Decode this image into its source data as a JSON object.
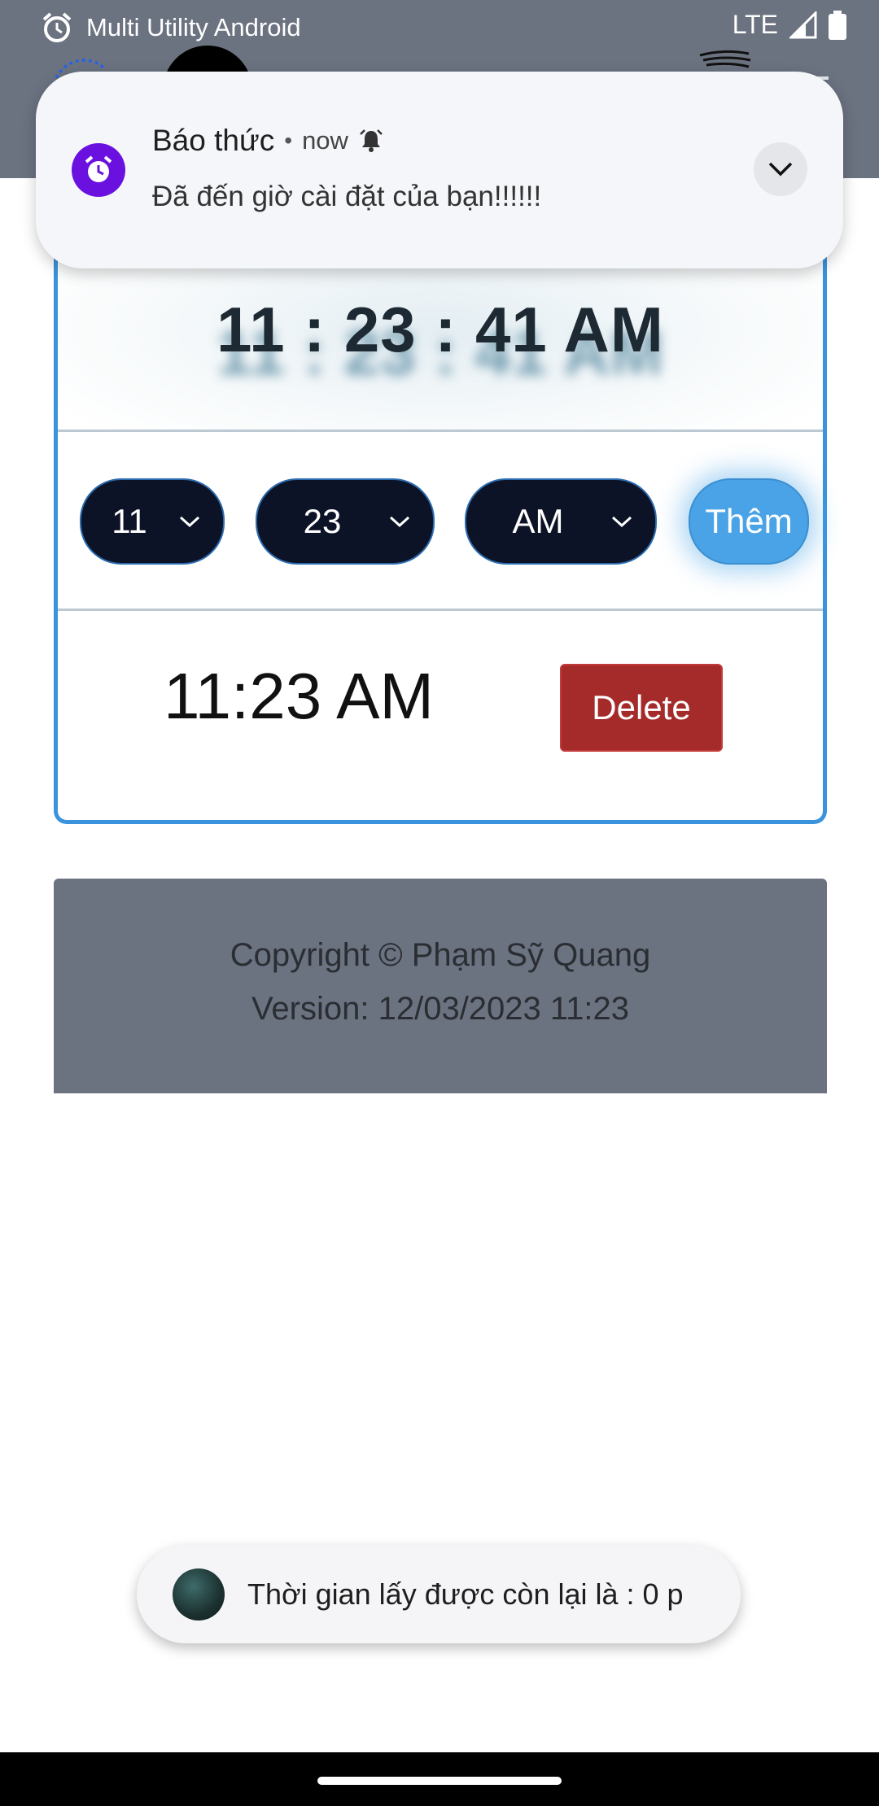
{
  "status_bar": {
    "app_name": "Multi Utility Android",
    "network": "LTE"
  },
  "notification": {
    "app": "Báo thức",
    "separator": "•",
    "time": "now",
    "message": "Đã đến giờ cài đặt của bạn!!!!!!"
  },
  "clock": {
    "display": "11 : 23 : 41 AM"
  },
  "controls": {
    "hour": "11",
    "minute": "23",
    "ampm": "AM",
    "add_label": "Thêm"
  },
  "alarms": [
    {
      "time": "11:23 AM",
      "delete_label": "Delete"
    }
  ],
  "footer": {
    "copyright": "Copyright © Phạm Sỹ Quang",
    "version": "Version: 12/03/2023 11:23"
  },
  "toast": {
    "message": "Thời gian lấy được còn lại là : 0 p"
  },
  "colors": {
    "header": "#6b7280",
    "accent": "#3b93dd",
    "select_bg": "#0d1326",
    "add_button": "#4aa3e6",
    "delete_button": "#a52a2a",
    "notif_icon": "#6a11e0"
  }
}
